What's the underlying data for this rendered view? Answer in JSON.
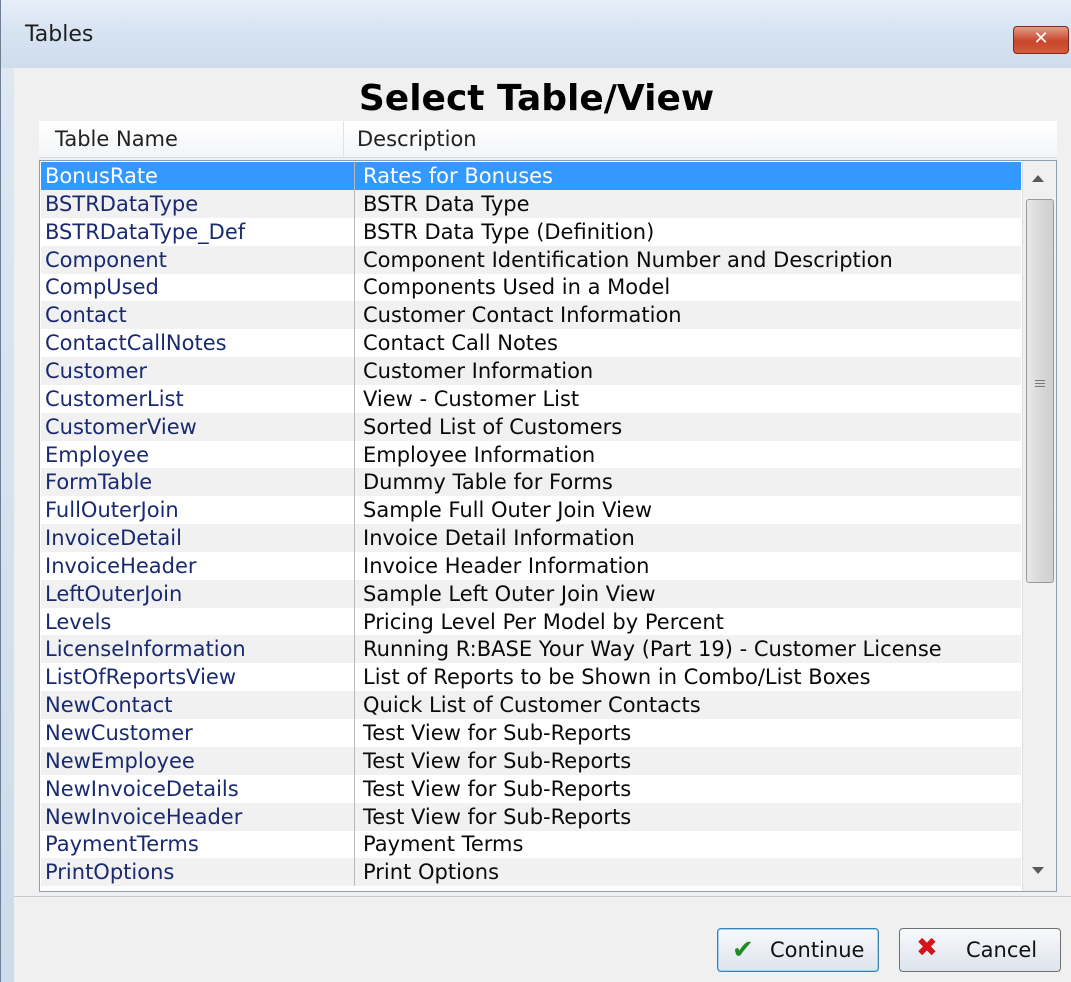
{
  "window": {
    "title": "Tables",
    "close_glyph": "✕"
  },
  "dialog": {
    "heading": "Select Table/View",
    "columns": [
      "Table Name",
      "Description"
    ],
    "rows": [
      {
        "name": "BonusRate",
        "description": "Rates for Bonuses",
        "selected": true
      },
      {
        "name": "BSTRDataType",
        "description": "BSTR Data Type"
      },
      {
        "name": "BSTRDataType_Def",
        "description": "BSTR Data Type (Definition)"
      },
      {
        "name": "Component",
        "description": "Component Identification Number and Description"
      },
      {
        "name": "CompUsed",
        "description": "Components Used in a Model"
      },
      {
        "name": "Contact",
        "description": "Customer Contact Information"
      },
      {
        "name": "ContactCallNotes",
        "description": "Contact Call Notes"
      },
      {
        "name": "Customer",
        "description": "Customer Information"
      },
      {
        "name": "CustomerList",
        "description": "View - Customer List"
      },
      {
        "name": "CustomerView",
        "description": "Sorted List of Customers"
      },
      {
        "name": "Employee",
        "description": "Employee Information"
      },
      {
        "name": "FormTable",
        "description": "Dummy Table for Forms"
      },
      {
        "name": "FullOuterJoin",
        "description": "Sample Full Outer Join View"
      },
      {
        "name": "InvoiceDetail",
        "description": "Invoice Detail Information"
      },
      {
        "name": "InvoiceHeader",
        "description": "Invoice Header Information"
      },
      {
        "name": "LeftOuterJoin",
        "description": "Sample Left Outer Join View"
      },
      {
        "name": "Levels",
        "description": "Pricing Level Per Model by Percent"
      },
      {
        "name": "LicenseInformation",
        "description": "Running R:BASE Your Way (Part 19) - Customer License"
      },
      {
        "name": "ListOfReportsView",
        "description": "List of Reports to be Shown in Combo/List Boxes"
      },
      {
        "name": "NewContact",
        "description": "Quick List of Customer Contacts"
      },
      {
        "name": "NewCustomer",
        "description": "Test View for Sub-Reports"
      },
      {
        "name": "NewEmployee",
        "description": "Test View for Sub-Reports"
      },
      {
        "name": "NewInvoiceDetails",
        "description": "Test View for Sub-Reports"
      },
      {
        "name": "NewInvoiceHeader",
        "description": "Test View for Sub-Reports"
      },
      {
        "name": "PaymentTerms",
        "description": "Payment Terms"
      },
      {
        "name": "PrintOptions",
        "description": "Print Options"
      }
    ]
  },
  "buttons": {
    "continue_label": "Continue",
    "continue_icon": "checkmark-icon",
    "cancel_label": "Cancel",
    "cancel_icon": "x-icon"
  },
  "colors": {
    "selection": "#3399ff",
    "title_bar": "#d7e4f2",
    "close_button": "#c7462c"
  }
}
